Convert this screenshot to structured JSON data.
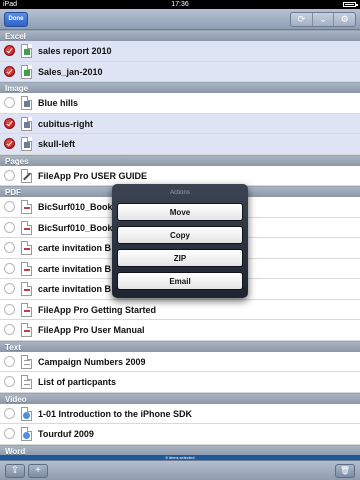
{
  "status_bar": {
    "device": "iPad",
    "time": "17:36"
  },
  "nav": {
    "done_label": "Done",
    "actions": [
      "⟳",
      "⌄",
      "⚙"
    ]
  },
  "sections": [
    {
      "title": "Excel",
      "items": [
        {
          "label": "sales report 2010",
          "selected": true,
          "icon": "excel-file-icon",
          "type": "xls"
        },
        {
          "label": "Sales_jan-2010",
          "selected": true,
          "icon": "excel-file-icon",
          "type": "xls"
        }
      ]
    },
    {
      "title": "Image",
      "items": [
        {
          "label": "Blue hills",
          "selected": false,
          "icon": "image-file-icon",
          "type": "img"
        },
        {
          "label": "cubitus-right",
          "selected": true,
          "icon": "image-file-icon",
          "type": "img"
        },
        {
          "label": "skull-left",
          "selected": true,
          "icon": "image-file-icon",
          "type": "img"
        }
      ]
    },
    {
      "title": "Pages",
      "items": [
        {
          "label": "FileApp Pro USER GUIDE",
          "selected": false,
          "icon": "pages-file-icon",
          "type": "pages"
        }
      ]
    },
    {
      "title": "PDF",
      "items": [
        {
          "label": "BicSurf010_Book",
          "selected": false,
          "icon": "pdf-file-icon",
          "type": "pdf"
        },
        {
          "label": "BicSurf010_Book",
          "selected": false,
          "icon": "pdf-file-icon",
          "type": "pdf"
        },
        {
          "label": "carte invitation B",
          "selected": false,
          "icon": "pdf-file-icon",
          "type": "pdf"
        },
        {
          "label": "carte invitation B",
          "selected": false,
          "icon": "pdf-file-icon",
          "type": "pdf"
        },
        {
          "label": "carte invitation B",
          "selected": false,
          "icon": "pdf-file-icon",
          "type": "pdf"
        },
        {
          "label": "FileApp Pro Getting Started",
          "selected": false,
          "icon": "pdf-file-icon",
          "type": "pdf"
        },
        {
          "label": "FileApp Pro User Manual",
          "selected": false,
          "icon": "pdf-file-icon",
          "type": "pdf"
        }
      ]
    },
    {
      "title": "Text",
      "items": [
        {
          "label": "Campaign Numbers 2009",
          "selected": false,
          "icon": "text-file-icon",
          "type": "txt"
        },
        {
          "label": "List of particpants",
          "selected": false,
          "icon": "text-file-icon",
          "type": "txt"
        }
      ]
    },
    {
      "title": "Video",
      "items": [
        {
          "label": "1-01 Introduction to the iPhone SDK",
          "selected": false,
          "icon": "video-file-icon",
          "type": "video"
        },
        {
          "label": "Tourduf 2009",
          "selected": false,
          "icon": "video-file-icon",
          "type": "video"
        }
      ]
    },
    {
      "title": "Word",
      "items": []
    }
  ],
  "popover": {
    "title": "Actions",
    "buttons": [
      "Move",
      "Copy",
      "ZIP",
      "Email"
    ]
  },
  "selection_bar": "6 items selected",
  "toolbar": {
    "share": "⇪",
    "add": "+",
    "trash": "🗑"
  },
  "colors": {
    "accent": "#2e63c8",
    "selected_row": "#dfe4f5",
    "check_red": "#c41b1b"
  }
}
